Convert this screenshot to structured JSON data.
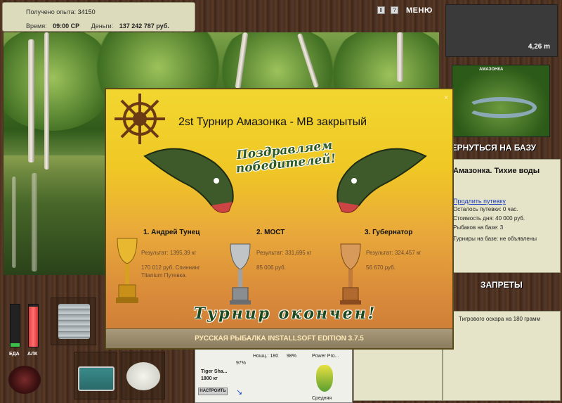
{
  "stats": {
    "exp_label": "Получено опыта:",
    "exp_value": "34150",
    "time_label": "Время:",
    "time_value": "09:00 СР",
    "money_label": "Деньги:",
    "money_value": "137 242 787 руб."
  },
  "top_right": {
    "pause_glyph": "II",
    "help_glyph": "?",
    "menu_label": "МЕНЮ",
    "depth_value": "4,26 m",
    "map_title": "АМАЗОНКА"
  },
  "sidebar": {
    "back_button": "ВЕРНУТЬСЯ НА БАЗУ",
    "location_title": "Амазонка. Тихие воды",
    "extend_link": "Продлить путевку",
    "lines": [
      "Осталось путевки: 0 час.",
      "Стоимость дня: 40 000 руб.",
      "Рыбаков на базе: 3",
      "Турниры на базе: не объявлены"
    ],
    "bans_button": "ЗАПРЕТЫ",
    "ban_text": "Тигрового оскара на 180 грамм"
  },
  "bottom": {
    "food_label": "ЕДА",
    "alco_label": "АЛК",
    "food_level": 0.08,
    "alco_level": 0.95,
    "rod_name": "Tiger Sha...",
    "rod_weight": "1800 кг",
    "rod_percent": "97%",
    "line_label": "Ношц.: 180",
    "line_percent": "98%",
    "lure_name": "Power Pro...",
    "lure_size": "Средняя",
    "set_button": "НАСТРОИТЬ"
  },
  "dialog": {
    "title": "2st Турнир Амазонка - MB закрытый",
    "congrats": "Поздравляем победителей!",
    "over": "Турнир окончен!",
    "footer": "РУССКАЯ РЫБАЛКА INSTALLSOFT EDITION 3.7.5",
    "close": "×",
    "winners": [
      {
        "place": "1. Андрей Тунец",
        "result": "Результат: 1395,39 кг",
        "prize": "170 012 руб. Спиннинг Titanium Путевка."
      },
      {
        "place": "2. МОСТ",
        "result": "Результат: 331,695 кг",
        "prize": "85 006 руб."
      },
      {
        "place": "3. Губернатор",
        "result": "Результат: 324,457 кг",
        "prize": "56 670 руб."
      }
    ]
  }
}
